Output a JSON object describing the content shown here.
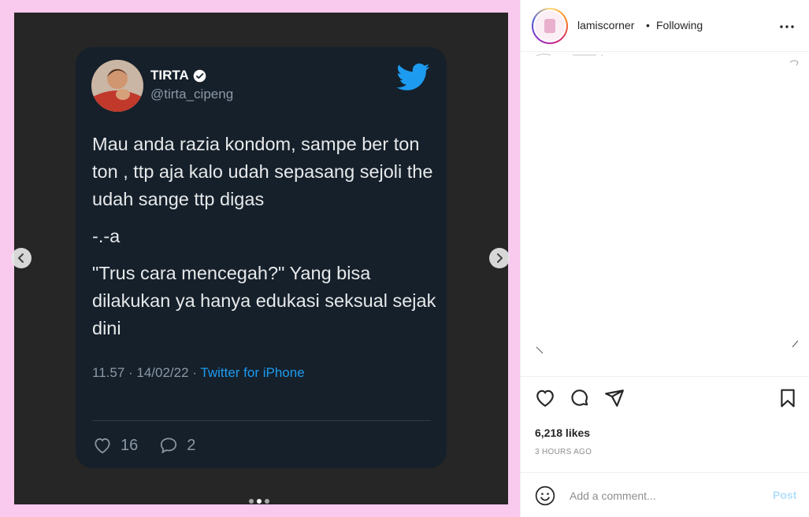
{
  "post": {
    "tweet": {
      "name": "TIRTA",
      "handle": "@tirta_cipeng",
      "text": [
        "Mau anda razia kondom, sampe ber ton ton , ttp aja kalo udah sepasang sejoli the udah sange ttp digas",
        "-.-a",
        "\"Trus cara mencegah?\" Yang bisa dilakukan ya hanya edukasi seksual sejak dini"
      ],
      "time_date": "11.57 · 14/02/22 · ",
      "source": "Twitter for iPhone",
      "likes": "16",
      "replies": "2",
      "accent": "#1d9bf0"
    },
    "carousel": {
      "slides": 3,
      "active_index": 1
    }
  },
  "header": {
    "username": "lamiscorner",
    "separator": "•",
    "follow_status": "Following"
  },
  "actions": {
    "likes_text": "6,218 likes",
    "time_ago": "3 HOURS AGO"
  },
  "comment": {
    "placeholder": "Add a comment...",
    "post_label": "Post"
  },
  "colors": {
    "media_bg": "#f9c9ee",
    "frame_bg": "#262626",
    "card_bg": "#15202b",
    "post_disabled": "#b2dffc"
  }
}
